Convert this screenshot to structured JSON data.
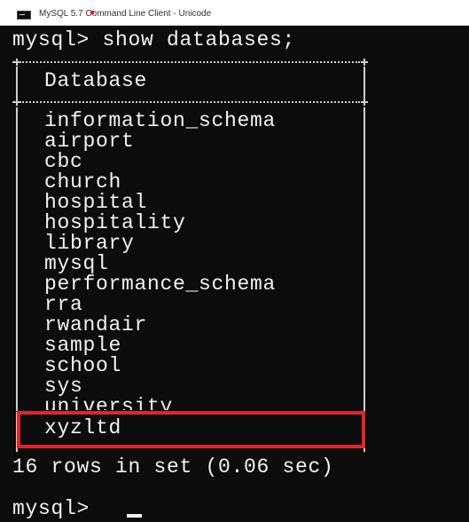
{
  "window": {
    "title": "MySQL 5.7 Command Line Client - Unicode",
    "icon": "console-icon"
  },
  "console": {
    "command_line": "mysql> show databases;",
    "column_header": "Database",
    "databases": [
      "information_schema",
      "airport",
      "cbc",
      "church",
      "hospital",
      "hospitality",
      "library",
      "mysql",
      "performance_schema",
      "rra",
      "rwandair",
      "sample",
      "school",
      "sys",
      "university",
      "xyzltd"
    ],
    "result_summary": "16 rows in set (0.06 sec)",
    "prompt": "mysql>"
  },
  "colors": {
    "console_background": "#0c0c0c",
    "console_text": "#f2f2f2",
    "table_border": "#cfcfcf",
    "highlight_box": "#e2252b",
    "title_background": "#ffffff"
  }
}
